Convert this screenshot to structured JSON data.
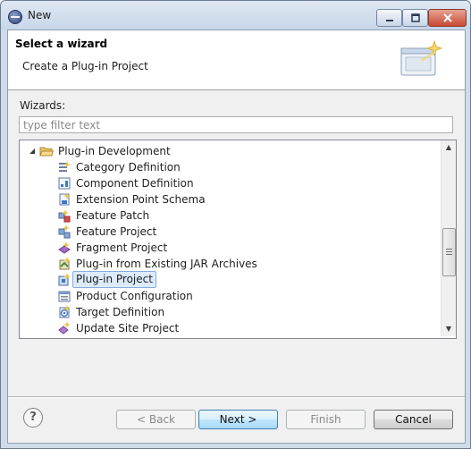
{
  "window": {
    "title": "New",
    "controls": {
      "minimize": "▭",
      "maximize": "□",
      "close": "✕"
    }
  },
  "banner": {
    "title": "Select a wizard",
    "description": "Create a Plug-in Project"
  },
  "wizards": {
    "label": "Wizards:",
    "filter_placeholder": "type filter text",
    "filter_value": ""
  },
  "tree": {
    "group": {
      "label": "Plug-in Development",
      "expanded": true,
      "icon": "folder-open-icon"
    },
    "items": [
      {
        "label": "Category Definition",
        "icon": "category-icon",
        "selected": false
      },
      {
        "label": "Component Definition",
        "icon": "component-icon",
        "selected": false
      },
      {
        "label": "Extension Point Schema",
        "icon": "schema-icon",
        "selected": false
      },
      {
        "label": "Feature Patch",
        "icon": "feature-patch-icon",
        "selected": false
      },
      {
        "label": "Feature Project",
        "icon": "feature-project-icon",
        "selected": false
      },
      {
        "label": "Fragment Project",
        "icon": "fragment-icon",
        "selected": false
      },
      {
        "label": "Plug-in from Existing JAR Archives",
        "icon": "jar-plugin-icon",
        "selected": false
      },
      {
        "label": "Plug-in Project",
        "icon": "plugin-project-icon",
        "selected": true
      },
      {
        "label": "Product Configuration",
        "icon": "product-icon",
        "selected": false
      },
      {
        "label": "Target Definition",
        "icon": "target-icon",
        "selected": false
      },
      {
        "label": "Update Site Project",
        "icon": "update-site-icon",
        "selected": false
      }
    ]
  },
  "buttons": {
    "help": "?",
    "back": "< Back",
    "next": "Next >",
    "finish": "Finish",
    "cancel": "Cancel"
  },
  "colors": {
    "selection_bg": "#dcebfc",
    "selection_border": "#84acdd",
    "default_button": "#3c7fb1"
  }
}
